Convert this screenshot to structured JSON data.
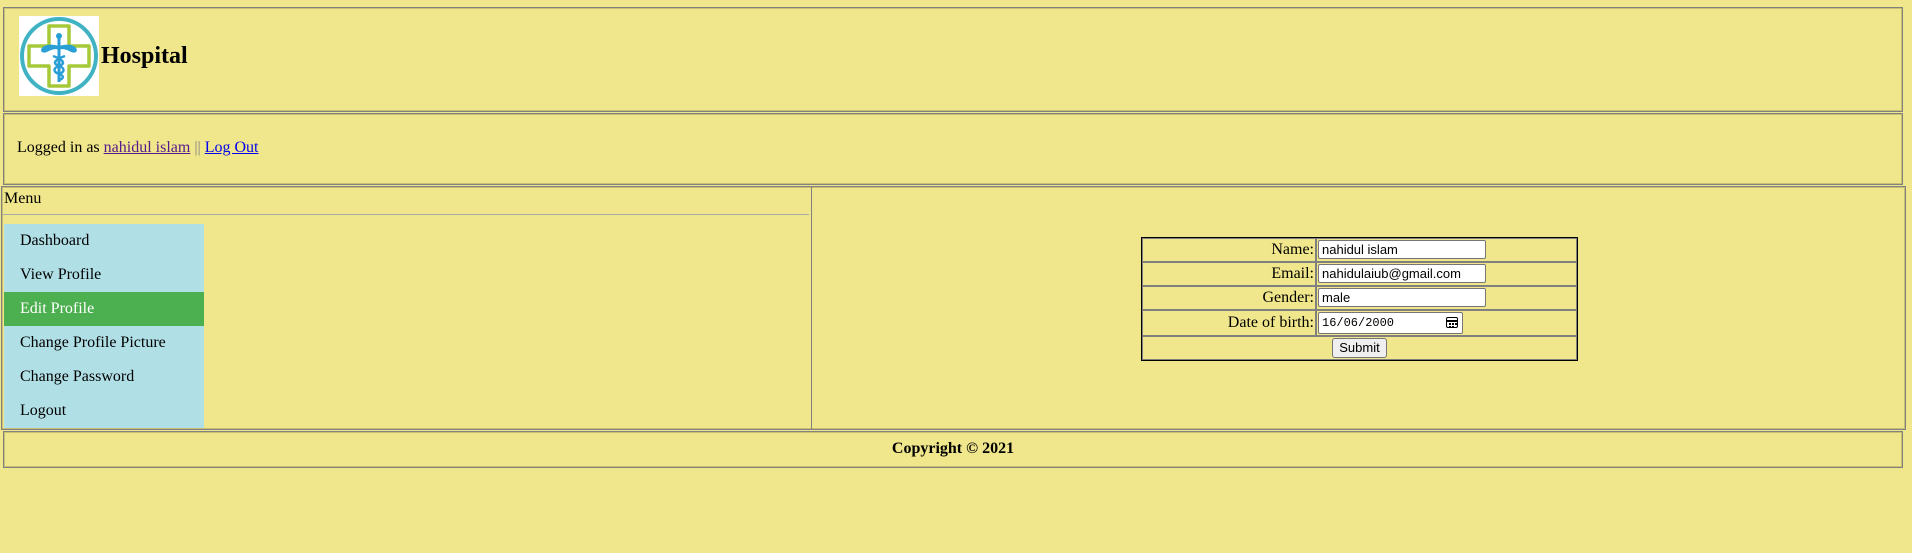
{
  "header": {
    "title": "Hospital"
  },
  "login_bar": {
    "prefix": "Logged in as",
    "user_name": "nahidul islam",
    "separator": "||",
    "logout_label": "Log Out"
  },
  "menu": {
    "title": "Menu",
    "items": [
      {
        "label": "Dashboard",
        "active": false
      },
      {
        "label": "View Profile",
        "active": false
      },
      {
        "label": "Edit Profile",
        "active": true
      },
      {
        "label": "Change Profile Picture",
        "active": false
      },
      {
        "label": "Change Password",
        "active": false
      },
      {
        "label": "Logout",
        "active": false
      }
    ]
  },
  "form": {
    "name_label": "Name:",
    "name_value": "nahidul islam",
    "email_label": "Email:",
    "email_value": "nahidulaiub@gmail.com",
    "gender_label": "Gender:",
    "gender_value": "male",
    "dob_label": "Date of birth:",
    "dob_value": "16/06/2000",
    "submit_label": "Submit"
  },
  "footer": {
    "copyright": "Copyright © 2021"
  },
  "colors": {
    "background": "#f0e68c",
    "menu_background": "#b0e0e6",
    "menu_active": "#4caf50",
    "logo_ring": "#3fb3c4",
    "logo_cross": "#a6c93a",
    "caduceus": "#2a9fd6"
  }
}
